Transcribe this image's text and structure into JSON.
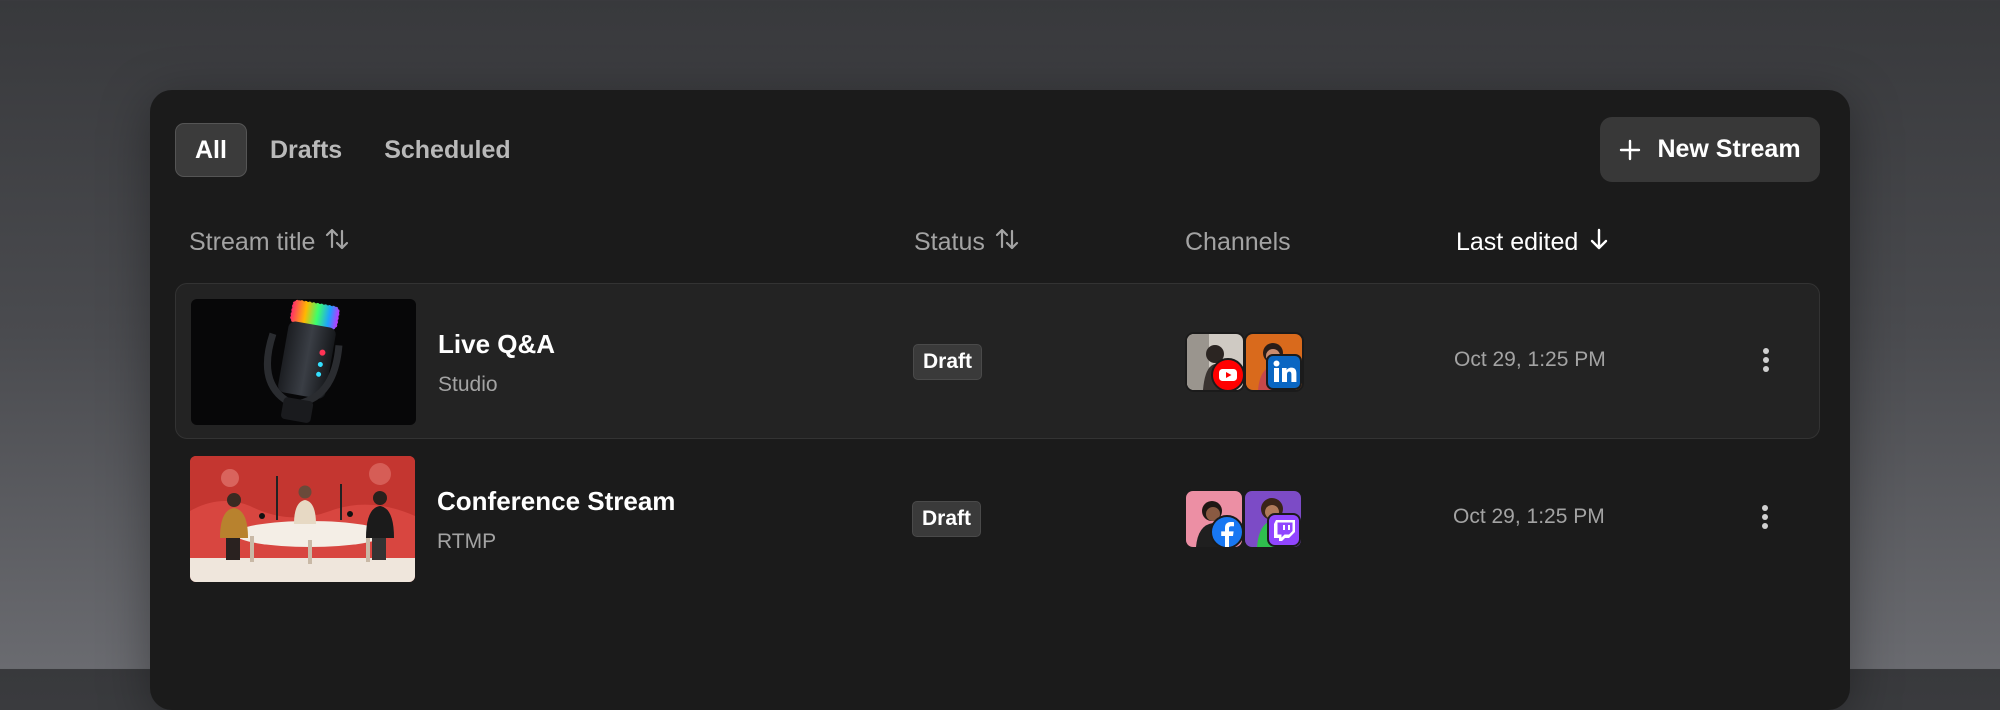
{
  "tabs": [
    {
      "label": "All",
      "active": true
    },
    {
      "label": "Drafts",
      "active": false
    },
    {
      "label": "Scheduled",
      "active": false
    }
  ],
  "new_stream_label": "New Stream",
  "columns": {
    "title": "Stream title",
    "status": "Status",
    "channels": "Channels",
    "last_edited": "Last edited"
  },
  "sort": {
    "column": "last_edited",
    "direction": "descending"
  },
  "streams": [
    {
      "title": "Live Q&A",
      "source": "Studio",
      "status": "Draft",
      "channels": [
        "youtube",
        "linkedin"
      ],
      "last_edited": "Oct 29, 1:25 PM",
      "thumbnail": "microphone-photo",
      "highlighted": true
    },
    {
      "title": "Conference Stream",
      "source": "RTMP",
      "status": "Draft",
      "channels": [
        "facebook",
        "twitch"
      ],
      "last_edited": "Oct 29, 1:25 PM",
      "thumbnail": "panel-discussion-photo",
      "highlighted": false
    }
  ],
  "colors": {
    "page_bg": "#3c3d40",
    "panel_bg": "#1b1b1b",
    "row_highlight": "#232323",
    "badge_bg": "#3a3a3a",
    "button_bg": "#383838",
    "youtube": "#ff0000",
    "linkedin": "#0a66c2",
    "facebook": "#1877f2",
    "twitch": "#9146ff"
  }
}
